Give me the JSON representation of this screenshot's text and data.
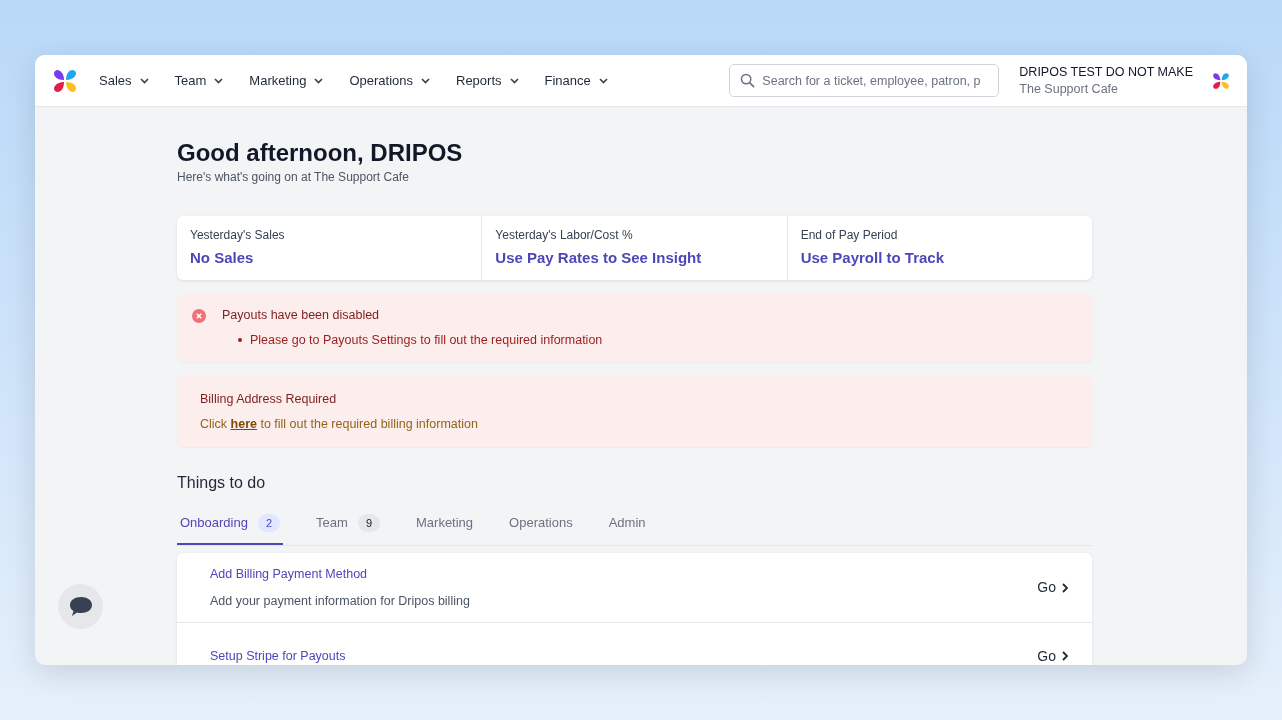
{
  "nav": {
    "items": [
      {
        "label": "Sales"
      },
      {
        "label": "Team"
      },
      {
        "label": "Marketing"
      },
      {
        "label": "Operations"
      },
      {
        "label": "Reports"
      },
      {
        "label": "Finance"
      }
    ],
    "search": {
      "placeholder": "Search for a ticket, employee, patron, p"
    },
    "account": {
      "name": "DRIPOS TEST DO NOT MAKE",
      "location": "The Support Cafe"
    }
  },
  "greeting": {
    "title": "Good afternoon, DRIPOS",
    "subtitle": "Here's what's going on at The Support Cafe"
  },
  "stats": [
    {
      "label": "Yesterday's Sales",
      "value": "No Sales"
    },
    {
      "label": "Yesterday's Labor/Cost %",
      "value": "Use Pay Rates to See Insight"
    },
    {
      "label": "End of Pay Period",
      "value": "Use Payroll to Track"
    }
  ],
  "alerts": [
    {
      "kind": "error",
      "title": "Payouts have been disabled",
      "bullets": [
        "Please go to Payouts Settings to fill out the required information"
      ]
    },
    {
      "kind": "notice",
      "title": "Billing Address Required",
      "before": "Click",
      "link": "here",
      "after": "to fill out the required billing information"
    }
  ],
  "todo": {
    "title": "Things to do",
    "tabs": [
      {
        "label": "Onboarding",
        "count": "2",
        "selected": true
      },
      {
        "label": "Team",
        "count": "9",
        "selected": false
      },
      {
        "label": "Marketing",
        "selected": false
      },
      {
        "label": "Operations",
        "selected": false
      },
      {
        "label": "Admin",
        "selected": false
      }
    ],
    "tasks": [
      {
        "title": "Add Billing Payment Method",
        "description": "Add your payment information for Dripos billing",
        "action": "Go"
      },
      {
        "title": "Setup Stripe for Payouts",
        "action": "Go"
      }
    ]
  }
}
